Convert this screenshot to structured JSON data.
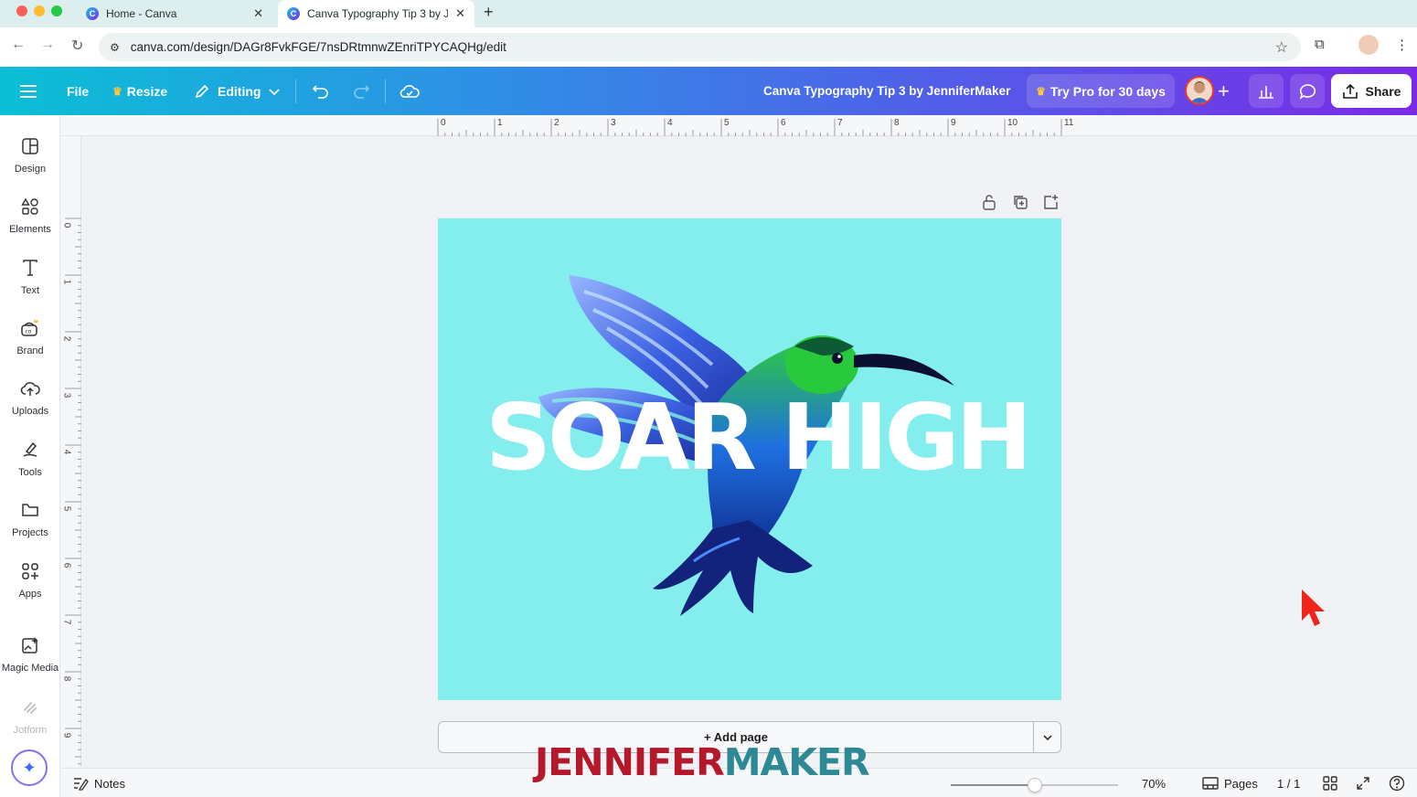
{
  "browser": {
    "tabs": [
      {
        "title": "Home - Canva",
        "active": false
      },
      {
        "title": "Canva Typography Tip 3 by J",
        "active": true
      }
    ],
    "new_tab_label": "+",
    "url": "canva.com/design/DAGr8FvkFGE/7nsDRtmnwZEnriTPYCAQHg/edit"
  },
  "toolbar": {
    "file_label": "File",
    "resize_label": "Resize",
    "editing_label": "Editing",
    "design_title": "Canva Typography Tip 3 by JenniferMaker",
    "try_pro_label": "Try Pro for 30 days",
    "share_label": "Share"
  },
  "sidebar": {
    "items": [
      {
        "label": "Design",
        "icon": "design-icon"
      },
      {
        "label": "Elements",
        "icon": "elements-icon"
      },
      {
        "label": "Text",
        "icon": "text-icon"
      },
      {
        "label": "Brand",
        "icon": "brand-icon"
      },
      {
        "label": "Uploads",
        "icon": "uploads-icon"
      },
      {
        "label": "Tools",
        "icon": "tools-icon"
      },
      {
        "label": "Projects",
        "icon": "projects-icon"
      },
      {
        "label": "Apps",
        "icon": "apps-icon"
      },
      {
        "label": "Magic Media",
        "icon": "magic-media-icon"
      },
      {
        "label": "Jotform",
        "icon": "jotform-icon"
      }
    ]
  },
  "rulers": {
    "top": [
      "0",
      "1",
      "2",
      "3",
      "4",
      "5",
      "6",
      "7",
      "8",
      "9",
      "10",
      "11"
    ],
    "left": [
      "0",
      "1",
      "2",
      "3",
      "4",
      "5",
      "6",
      "7",
      "8",
      "9"
    ]
  },
  "canvas": {
    "headline": "SOAR HIGH",
    "background_color": "#84eeee",
    "add_page_label": "+ Add page"
  },
  "bottombar": {
    "notes_label": "Notes",
    "zoom_percent": "70%",
    "zoom_level": 0.5,
    "pages_label": "Pages",
    "page_counter": "1 / 1"
  },
  "watermark": {
    "part1": "JENNIFER",
    "part2": "MAKER"
  },
  "colors": {
    "toolbar_gradient_start": "#0bbfd6",
    "toolbar_gradient_end": "#7a2ae6",
    "watermark_red": "#b5182a",
    "watermark_teal": "#2d8a95"
  }
}
